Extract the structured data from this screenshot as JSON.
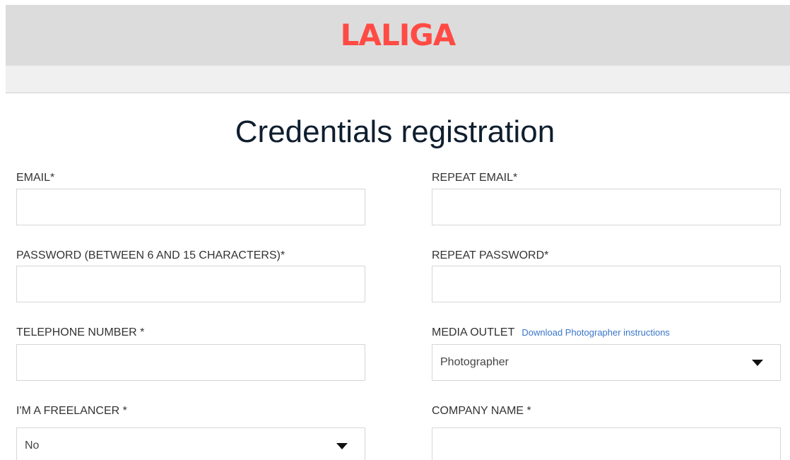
{
  "header": {
    "logo_text": "LALIGA"
  },
  "page_title": "Credentials registration",
  "form": {
    "email": {
      "label": "EMAIL*",
      "value": ""
    },
    "repeat_email": {
      "label": "REPEAT EMAIL*",
      "value": ""
    },
    "password": {
      "label": "PASSWORD (BETWEEN 6 AND 15 CHARACTERS)*",
      "value": ""
    },
    "repeat_password": {
      "label": "REPEAT PASSWORD*",
      "value": ""
    },
    "telephone": {
      "label": "TELEPHONE NUMBER *",
      "value": ""
    },
    "media_outlet": {
      "label": "MEDIA OUTLET",
      "link_text": "Download Photographer instructions",
      "selected": "Photographer"
    },
    "freelancer": {
      "label": "I'M A FREELANCER *",
      "selected": "No"
    },
    "company_name": {
      "label": "COMPANY NAME *",
      "value": ""
    }
  },
  "colors": {
    "brand": "#ff4b44",
    "header_bg": "#dcdcdc",
    "link": "#3a76c8",
    "title": "#0f1e2e"
  },
  "icons": {
    "select_caret": "chevron-down-icon"
  }
}
